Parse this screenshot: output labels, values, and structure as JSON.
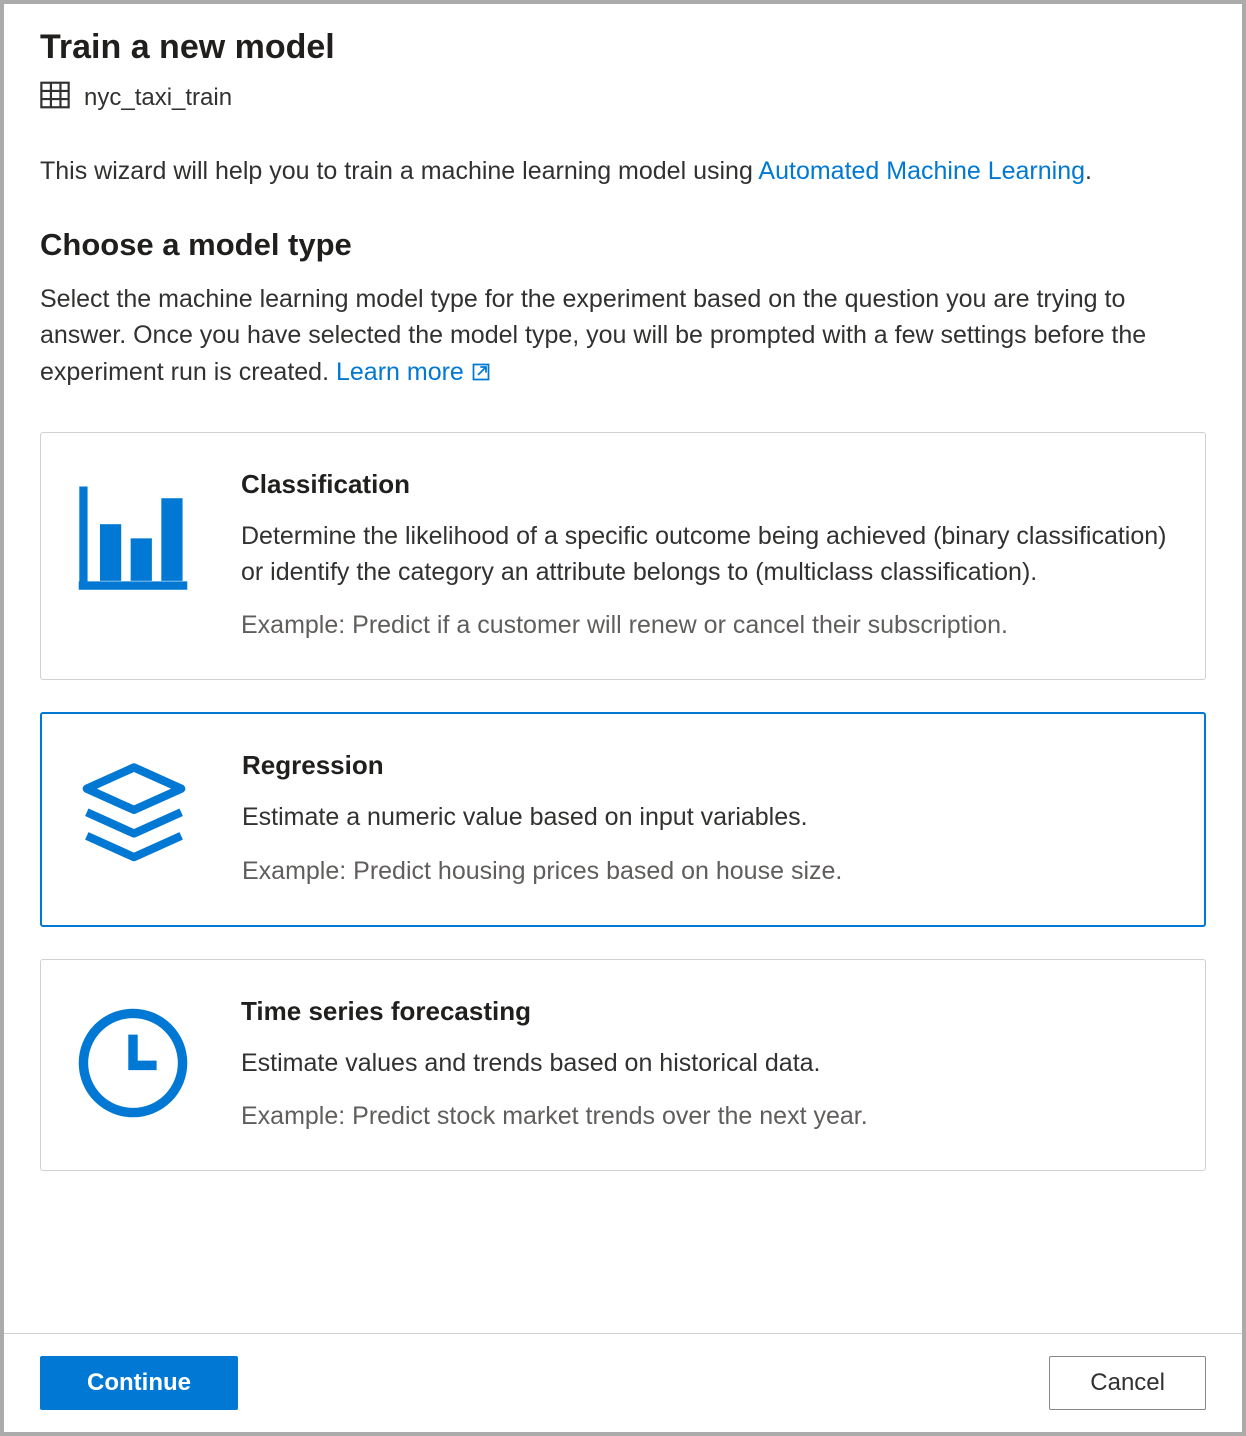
{
  "header": {
    "title": "Train a new model",
    "dataset_name": "nyc_taxi_train"
  },
  "intro": {
    "prefix": "This wizard will help you to train a machine learning model using ",
    "link_text": "Automated Machine Learning",
    "suffix": "."
  },
  "section": {
    "title": "Choose a model type",
    "desc_prefix": "Select the machine learning model type for the experiment based on the question you are trying to answer. Once you have selected the model type, you will be prompted with a few settings before the experiment run is created. ",
    "learn_more": "Learn more"
  },
  "cards": [
    {
      "id": "classification",
      "title": "Classification",
      "desc": "Determine the likelihood of a specific outcome being achieved (binary classification) or identify the category an attribute belongs to (multiclass classification).",
      "example": "Example: Predict if a customer will renew or cancel their subscription.",
      "selected": false
    },
    {
      "id": "regression",
      "title": "Regression",
      "desc": "Estimate a numeric value based on input variables.",
      "example": "Example: Predict housing prices based on house size.",
      "selected": true
    },
    {
      "id": "timeseries",
      "title": "Time series forecasting",
      "desc": "Estimate values and trends based on historical data.",
      "example": "Example: Predict stock market trends over the next year.",
      "selected": false
    }
  ],
  "footer": {
    "continue_label": "Continue",
    "cancel_label": "Cancel"
  }
}
